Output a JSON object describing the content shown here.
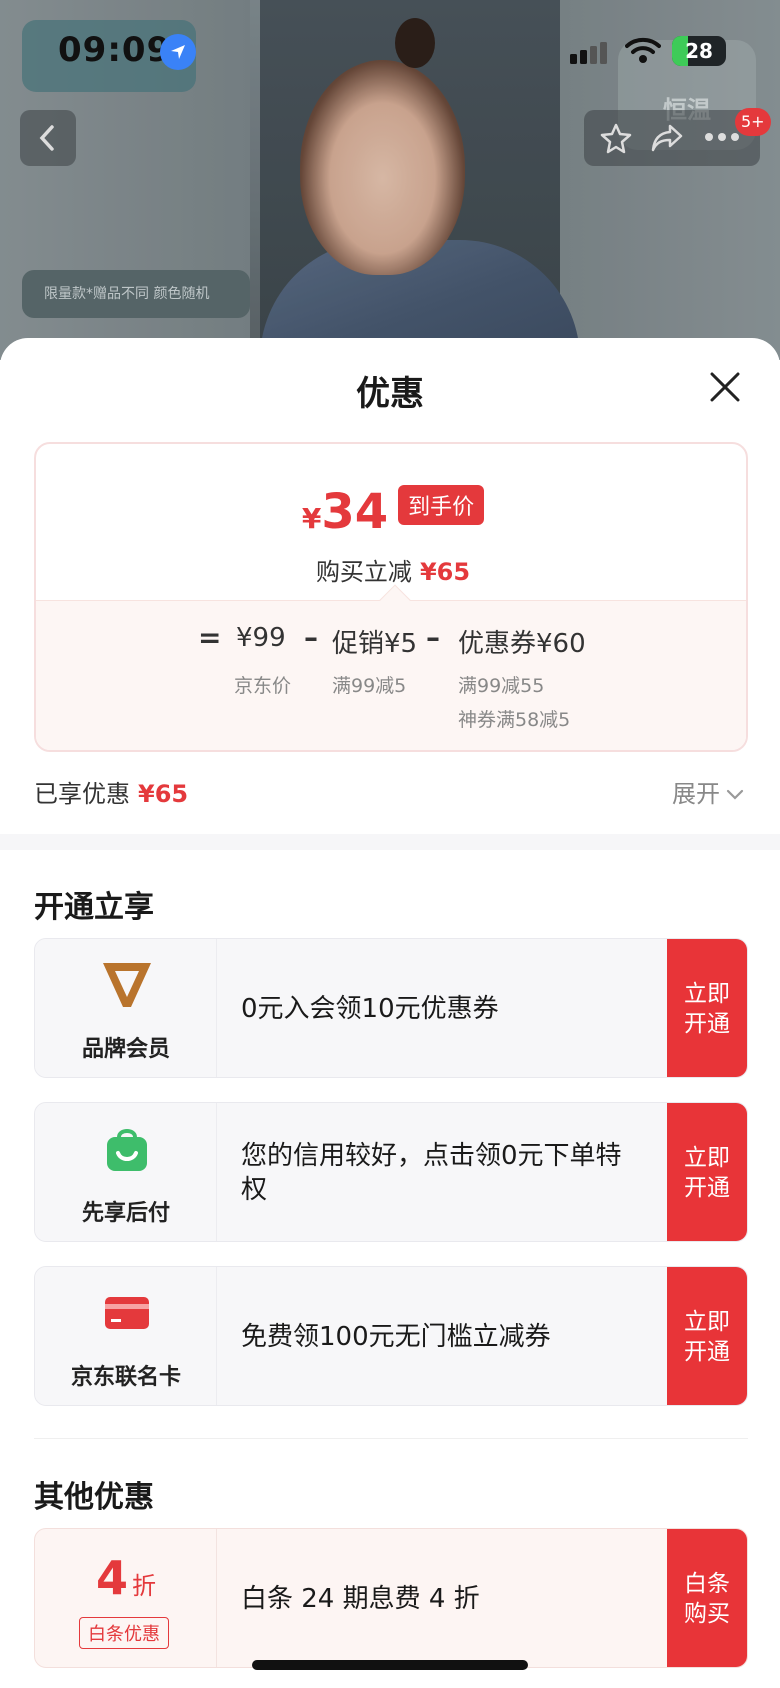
{
  "status_bar": {
    "time": "09:09",
    "battery": "28"
  },
  "background": {
    "tag_text": "限量款*赠品不同 颜色随机",
    "brand_logo": "恒温",
    "notification_count": "5+"
  },
  "sheet": {
    "title": "优惠",
    "price": {
      "currency": "¥",
      "value": "34",
      "badge": "到手价",
      "sub_label": "购买立减",
      "sub_value": "¥65"
    },
    "breakdown": {
      "equals": "=",
      "items": [
        {
          "amount": "¥99",
          "label": "京东价",
          "label2": ""
        },
        {
          "amount": "促销¥5",
          "label": "满99减5",
          "label2": ""
        },
        {
          "amount": "优惠券¥60",
          "label": "满99减55",
          "label2": "神券满58减5"
        }
      ],
      "minus": "–"
    },
    "enjoyed_label": "已享优惠",
    "enjoyed_value": "¥65",
    "expand_label": "展开",
    "section_open": "开通立享",
    "offers": [
      {
        "name": "品牌会员",
        "icon": "brand-vip-icon",
        "desc": "0元入会领10元优惠券",
        "button": "立即开通"
      },
      {
        "name": "先享后付",
        "icon": "shopping-bag-icon",
        "desc": "您的信用较好，点击领0元下单特权",
        "button": "立即开通"
      },
      {
        "name": "京东联名卡",
        "icon": "credit-card-icon",
        "desc": "免费领100元无门槛立减券",
        "button": "立即开通"
      }
    ],
    "section_other": "其他优惠",
    "baitiao": {
      "discount_num": "4",
      "discount_unit": "折",
      "tag": "白条优惠",
      "desc": "白条 24 期息费 4 折",
      "button": "白条购买"
    }
  },
  "colors": {
    "accent_red": "#e4393c",
    "button_red": "#e83438",
    "member_gold": "#b9742d",
    "green": "#3ebd6b"
  }
}
